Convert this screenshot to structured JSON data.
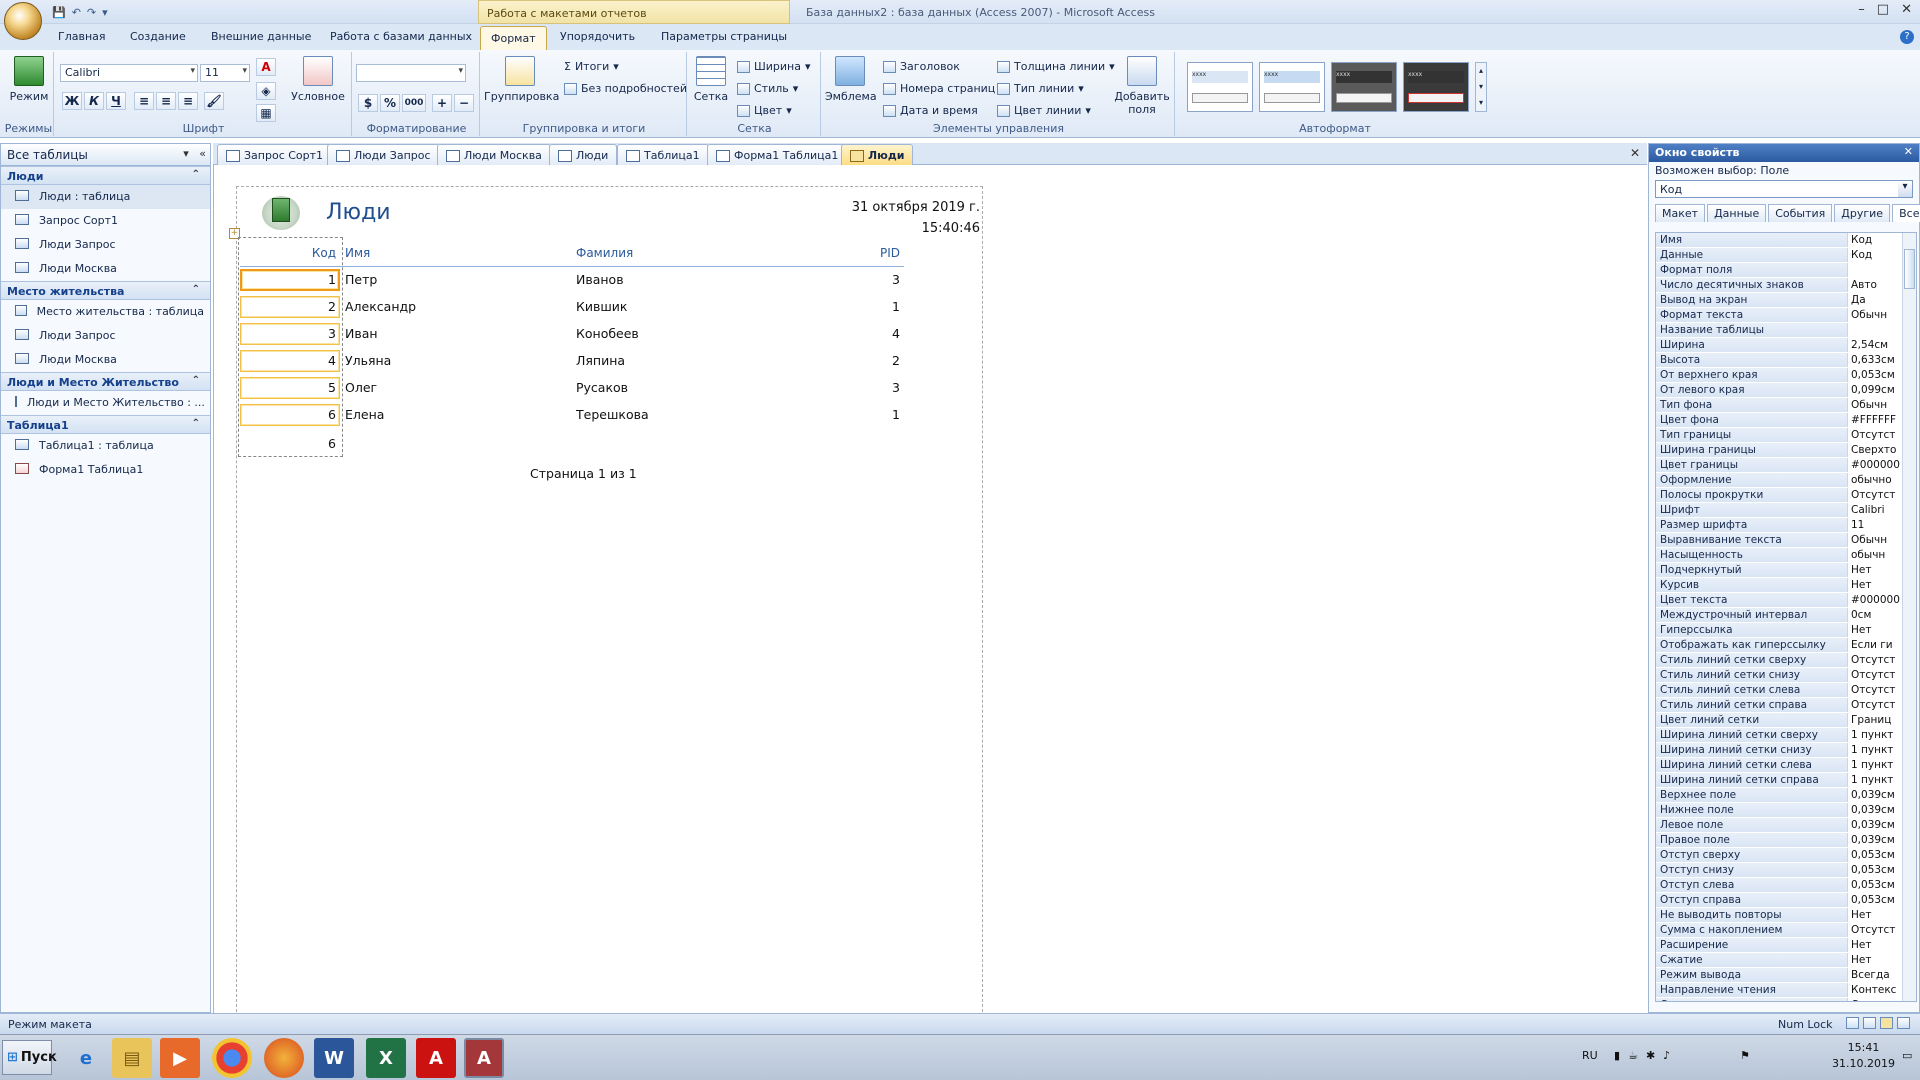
{
  "titlebar": {
    "context_tab_title": "Работа с макетами отчетов",
    "window_title": "База данных2 : база данных (Access 2007) - Microsoft Access",
    "minimize": "–",
    "maximize": "□",
    "close": "✕"
  },
  "tabs": [
    "Главная",
    "Создание",
    "Внешние данные",
    "Работа с базами данных",
    "Формат",
    "Упорядочить",
    "Параметры страницы"
  ],
  "ribbon": {
    "modes": {
      "label": "Режим",
      "group": "Режимы"
    },
    "font": {
      "name": "Calibri",
      "size": "11",
      "conditional": "Условное",
      "group": "Шрифт",
      "bold": "Ж",
      "italic": "К",
      "underline": "Ч"
    },
    "formatting": {
      "group": "Форматирование",
      "percent": "%",
      "thousands": "000"
    },
    "grouping": {
      "group_btn": "Группировка",
      "totals": "Итоги",
      "no_details": "Без подробностей",
      "group": "Группировка и итоги"
    },
    "grid": {
      "grid_btn": "Сетка",
      "width": "Ширина",
      "style": "Стиль",
      "color": "Цвет",
      "group": "Сетка"
    },
    "controls": {
      "logo": "Эмблема",
      "title": "Заголовок",
      "page_numbers": "Номера страниц",
      "datetime": "Дата и время",
      "line_width": "Толщина линии",
      "line_type": "Тип линии",
      "line_color": "Цвет линии",
      "add_fields_1": "Добавить",
      "add_fields_2": "поля",
      "group": "Элементы управления"
    },
    "autoformat": {
      "group": "Автоформат"
    }
  },
  "nav": {
    "title": "Все таблицы",
    "groups": [
      {
        "name": "Люди",
        "items": [
          {
            "label": "Люди : таблица",
            "type": "table"
          },
          {
            "label": "Запрос Сорт1",
            "type": "query"
          },
          {
            "label": "Люди Запрос",
            "type": "query"
          },
          {
            "label": "Люди Москва",
            "type": "query"
          }
        ]
      },
      {
        "name": "Место жительства",
        "items": [
          {
            "label": "Место жительства : таблица",
            "type": "table"
          },
          {
            "label": "Люди Запрос",
            "type": "query"
          },
          {
            "label": "Люди Москва",
            "type": "query"
          }
        ]
      },
      {
        "name": "Люди и Место Жительство",
        "items": [
          {
            "label": "Люди и Место Жительство : ...",
            "type": "query"
          }
        ]
      },
      {
        "name": "Таблица1",
        "items": [
          {
            "label": "Таблица1 : таблица",
            "type": "table"
          },
          {
            "label": "Форма1 Таблица1",
            "type": "form"
          }
        ]
      }
    ]
  },
  "doc_tabs": [
    "Запрос Сорт1",
    "Люди Запрос",
    "Люди Москва",
    "Люди",
    "Таблица1",
    "Форма1 Таблица1",
    "Люди"
  ],
  "report": {
    "title": "Люди",
    "date": "31 октября 2019 г.",
    "time": "15:40:46",
    "headers": {
      "kod": "Код",
      "name": "Имя",
      "surname": "Фамилия",
      "pid": "PID"
    },
    "rows": [
      {
        "kod": "1",
        "name": "Петр",
        "surname": "Иванов",
        "pid": "3"
      },
      {
        "kod": "2",
        "name": "Александр",
        "surname": "Кившик",
        "pid": "1"
      },
      {
        "kod": "3",
        "name": "Иван",
        "surname": "Конобеев",
        "pid": "4"
      },
      {
        "kod": "4",
        "name": "Ульяна",
        "surname": "Ляпина",
        "pid": "2"
      },
      {
        "kod": "5",
        "name": "Олег",
        "surname": "Русаков",
        "pid": "3"
      },
      {
        "kod": "6",
        "name": "Елена",
        "surname": "Терешкова",
        "pid": "1"
      }
    ],
    "count": "6",
    "page": "Страница 1 из 1"
  },
  "props": {
    "title": "Окно свойств",
    "subtitle": "Возможен выбор:  Поле",
    "selected": "Код",
    "tabs": [
      "Макет",
      "Данные",
      "События",
      "Другие",
      "Все"
    ],
    "rows": [
      [
        "Имя",
        "Код"
      ],
      [
        "Данные",
        "Код"
      ],
      [
        "Формат поля",
        ""
      ],
      [
        "Число десятичных знаков",
        "Авто"
      ],
      [
        "Вывод на экран",
        "Да"
      ],
      [
        "Формат текста",
        "Обычн"
      ],
      [
        "Название таблицы",
        ""
      ],
      [
        "Ширина",
        "2,54см"
      ],
      [
        "Высота",
        "0,633см"
      ],
      [
        "От верхнего края",
        "0,053см"
      ],
      [
        "От левого края",
        "0,099см"
      ],
      [
        "Тип фона",
        "Обычн"
      ],
      [
        "Цвет фона",
        "#FFFFFF"
      ],
      [
        "Тип границы",
        "Отсутст"
      ],
      [
        "Ширина границы",
        "Сверхто"
      ],
      [
        "Цвет границы",
        "#000000"
      ],
      [
        "Оформление",
        "обычно"
      ],
      [
        "Полосы прокрутки",
        "Отсутст"
      ],
      [
        "Шрифт",
        "Calibri"
      ],
      [
        "Размер шрифта",
        "11"
      ],
      [
        "Выравнивание текста",
        "Обычн"
      ],
      [
        "Насыщенность",
        "обычн"
      ],
      [
        "Подчеркнутый",
        "Нет"
      ],
      [
        "Курсив",
        "Нет"
      ],
      [
        "Цвет текста",
        "#000000"
      ],
      [
        "Междустрочный интервал",
        "0см"
      ],
      [
        "Гиперссылка",
        "Нет"
      ],
      [
        "Отображать как гиперссылку",
        "Если ги"
      ],
      [
        "Стиль линий сетки сверху",
        "Отсутст"
      ],
      [
        "Стиль линий сетки снизу",
        "Отсутст"
      ],
      [
        "Стиль линий сетки слева",
        "Отсутст"
      ],
      [
        "Стиль линий сетки справа",
        "Отсутст"
      ],
      [
        "Цвет линий сетки",
        "Границ"
      ],
      [
        "Ширина линий сетки сверху",
        "1 пункт"
      ],
      [
        "Ширина линий сетки снизу",
        "1 пункт"
      ],
      [
        "Ширина линий сетки слева",
        "1 пункт"
      ],
      [
        "Ширина линий сетки справа",
        "1 пункт"
      ],
      [
        "Верхнее поле",
        "0,039см"
      ],
      [
        "Нижнее поле",
        "0,039см"
      ],
      [
        "Левое поле",
        "0,039см"
      ],
      [
        "Правое поле",
        "0,039см"
      ],
      [
        "Отступ сверху",
        "0,053см"
      ],
      [
        "Отступ снизу",
        "0,053см"
      ],
      [
        "Отступ слева",
        "0,053см"
      ],
      [
        "Отступ справа",
        "0,053см"
      ],
      [
        "Не выводить повторы",
        "Нет"
      ],
      [
        "Сумма с накоплением",
        "Отсутст"
      ],
      [
        "Расширение",
        "Нет"
      ],
      [
        "Сжатие",
        "Нет"
      ],
      [
        "Режим вывода",
        "Всегда"
      ],
      [
        "Направление чтения",
        "Контекс"
      ],
      [
        "Согласование полосы прокрутки",
        "Систем"
      ]
    ]
  },
  "status": {
    "mode": "Режим макета",
    "numlock": "Num Lock"
  },
  "taskbar": {
    "start": "Пуск",
    "lang": "RU",
    "time": "15:41",
    "date": "31.10.2019"
  },
  "colors": {
    "accent": "#2c5aa0",
    "active_tab": "#fddd84",
    "selection": "#f09a1a"
  }
}
